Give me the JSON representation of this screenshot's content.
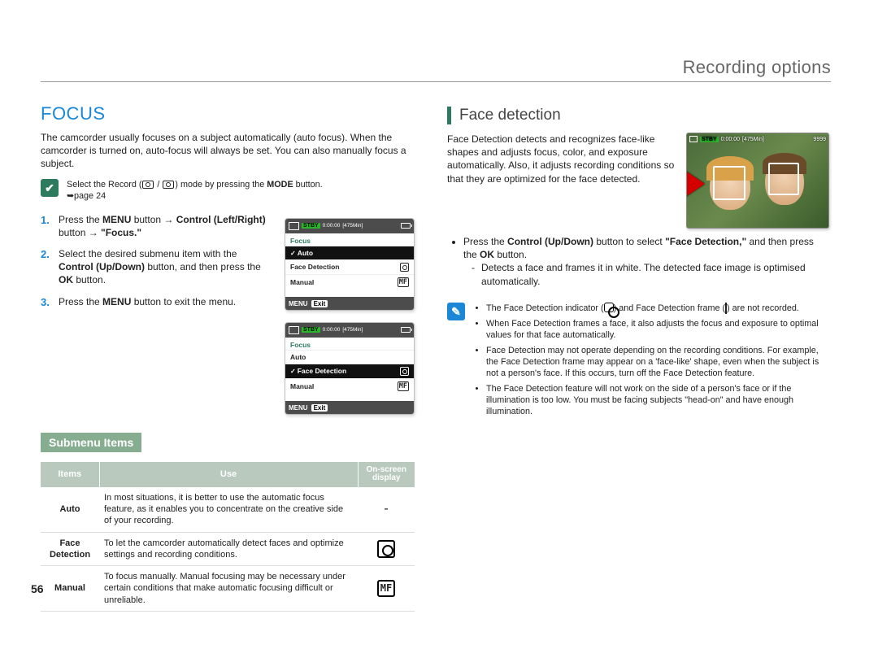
{
  "page": {
    "header_title": "Recording options",
    "number": "56"
  },
  "left": {
    "h1": "FOCUS",
    "intro": "The camcorder usually focuses on a subject automatically (auto focus). When the camcorder is turned on, auto-focus will always be set. You can also manually focus a subject.",
    "precheck": {
      "text_a": "Select the Record (",
      "text_b": " / ",
      "text_c": ") mode by pressing the ",
      "mode_bold": "MODE",
      "text_d": " button. ",
      "page_ref": "➥page 24"
    },
    "steps": {
      "s1": {
        "num": "1.",
        "a": "Press the ",
        "menu": "MENU",
        "b": " button → ",
        "ctrl": "Control (Left/Right)",
        "c": " button → ",
        "focus": "\"Focus.\""
      },
      "s2": {
        "num": "2.",
        "a": "Select the desired submenu item with the ",
        "ctrl": "Control (Up/Down)",
        "b": " button, and then press the ",
        "ok": "OK",
        "c": " button."
      },
      "s3": {
        "num": "3.",
        "a": "Press the ",
        "menu": "MENU",
        "b": " button to exit the menu."
      }
    },
    "lcd": {
      "stby": "STBY",
      "time": "0:00:00",
      "rem": "[475Min]",
      "title": "Focus",
      "item_auto": "Auto",
      "item_fd": "Face Detection",
      "item_manual": "Manual",
      "foot_menu": "MENU",
      "foot_exit": "Exit"
    },
    "submenu_heading": "Submenu Items",
    "table": {
      "th_items": "Items",
      "th_use": "Use",
      "th_osd_a": "On-screen",
      "th_osd_b": "display",
      "rows": {
        "auto": {
          "item": "Auto",
          "use": "In most situations, it is better to use the automatic focus feature, as it enables you to concentrate on the creative side of your recording.",
          "osd": "-"
        },
        "fd": {
          "item_a": "Face",
          "item_b": "Detection",
          "use": "To let the camcorder automatically detect faces and optimize settings and recording conditions."
        },
        "manual": {
          "item": "Manual",
          "use": "To focus manually. Manual focusing may be necessary under certain conditions that make automatic focusing difficult or unreliable."
        }
      }
    }
  },
  "right": {
    "h2": "Face detection",
    "intro": "Face Detection detects and recognizes face-like shapes and adjusts focus, color, and exposure automatically. Also, it adjusts recording conditions so that they are optimized for the face detected.",
    "bullet1": {
      "a": "Press the ",
      "ctrl": "Control (Up/Down)",
      "b": " button to select ",
      "fd": "\"Face Detection,\"",
      "c": " and then press the ",
      "ok": "OK",
      "d": " button."
    },
    "dash1": "Detects a face and frames it in white. The detected face image is optimised automatically.",
    "photo": {
      "stby": "STBY",
      "time": "0:00:00",
      "rem": "[475Min]",
      "count": "9999"
    },
    "notes": {
      "n1a": "The Face Detection indicator (",
      "n1b": ") and Face Detection frame (",
      "n1c": ") are not recorded.",
      "n2": "When Face Detection frames a face, it also adjusts the focus and exposure to optimal values for that face automatically.",
      "n3": "Face Detection may not operate depending on the recording conditions. For example, the Face Detection frame may appear on a 'face-like' shape, even when the subject is not a person's face. If this occurs, turn off the Face Detection feature.",
      "n4": "The Face Detection feature will not work on the side of a person's face or if the illumination is too low. You must be facing subjects \"head-on\" and have enough illumination."
    }
  }
}
